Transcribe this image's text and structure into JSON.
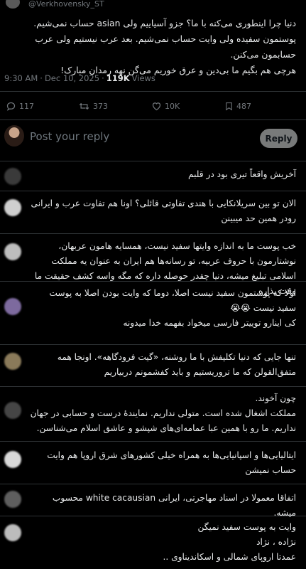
{
  "author": {
    "handle": "@Verkhovensky_ST"
  },
  "post": {
    "text": "دنیا چرا اینطوری می‌کنه با ما؟ جزو آسیاییم ولی asian حساب نمی‌شیم. پوستمون سفیده ولی وایت حساب نمی‌شیم. بعد عرب نیستیم ولی عرب حسابمون می‌کنن.\nهرچی هم بگیم ما بی‌دین و عرق خوریم می‌گن نهه رمدان مبارک!",
    "time": "9:30 AM",
    "separator": "·",
    "date": "Dec 10, 2025",
    "separator2": "·",
    "views_count": "119K",
    "views_label": "Views"
  },
  "stats": {
    "replies": "117",
    "reposts": "373",
    "likes": "10K",
    "bookmarks": "487"
  },
  "composer": {
    "placeholder": "Post your reply",
    "button": "Reply"
  },
  "replies": [
    {
      "text": "آخریش واقعاً تیری بود در قلبم"
    },
    {
      "text": "الان تو بین سریلانکایی با هندی تفاوتی قائلی؟ اونا هم تفاوت عرب و ایرانی رودر همین حد میبینن"
    },
    {
      "text": "خب پوست ما به اندازه وایتها سفید نیست، همسایه هامون عربهان، نوشتارمون با حروف عربیه، تو رسانه‌ها هم ایران به عنوان یه مملکت اسلامی تبلیغ میشه، دنیا چقدر حوصله داره که مگه واسه کشف حقیقت ما وقت بذاره"
    },
    {
      "text": "اولا که پوستمون سفید نیست اصلا، دوما که وایت بودن اصلا به پوست سفید نیست 😭😭\nکی اینارو توییتر فارسی میخواد بفهمه خدا میدونه"
    },
    {
      "text": "تنها جایی که دنیا تکلیفش با ما روشنه، «گیت فرودگاهه». اونجا همه متفق‌القولن که ما تروریستیم و باید کفشمونم دربیاریم"
    },
    {
      "text": "چون آخوند.\nمملکت اشغال شده است. متولی نداریم. نماینده‌ٔ درست و حسابی در جهان نداریم. ما رو با همین عبا عمامه‌ای‌های شپشو و عاشق اسلام می‌شناسن."
    },
    {
      "text": "ایتالیایی‌ها و اسپانیایی‌ها به همراه خیلی کشورهای شرق اروپا هم وایت حساب نمیشن"
    },
    {
      "text": "اتفاقا معمولا در اسناد مهاجرتی، ایرانی white cacausian محسوب میشه."
    },
    {
      "text": "وایت به پوست سفید نمیگن\nنژاده ، نژاد\nعمدتا اروپای شمالی و اسکاندیناوی .."
    }
  ]
}
